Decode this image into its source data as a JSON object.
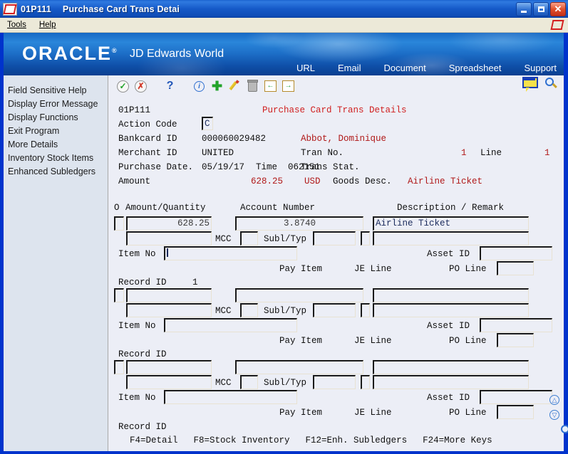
{
  "window": {
    "program_id": "01P111",
    "title": "Purchase Card Trans Detai",
    "minimize_label": "Minimize",
    "maximize_label": "Maximize",
    "close_label": "Close"
  },
  "menubar": {
    "items": [
      {
        "label": "Tools"
      },
      {
        "label": "Help"
      }
    ]
  },
  "banner": {
    "brand": "ORACLE",
    "trademark": "®",
    "product": "JD Edwards World",
    "links": [
      {
        "label": "URL"
      },
      {
        "label": "Email"
      },
      {
        "label": "Document"
      },
      {
        "label": "Spreadsheet"
      },
      {
        "label": "Support"
      }
    ]
  },
  "toolbar": {
    "icons": [
      {
        "name": "ok-check-icon",
        "label": "OK"
      },
      {
        "name": "cancel-x-icon",
        "label": "Cancel"
      },
      {
        "name": "help-question-icon",
        "label": "Help"
      },
      {
        "name": "info-icon",
        "label": "Info"
      },
      {
        "name": "add-plus-icon",
        "label": "Add"
      },
      {
        "name": "edit-pencil-icon",
        "label": "Edit"
      },
      {
        "name": "delete-trash-icon",
        "label": "Delete"
      },
      {
        "name": "previous-record-icon",
        "label": "Previous"
      },
      {
        "name": "next-record-icon",
        "label": "Next"
      }
    ],
    "note_icon_label": "Attachments",
    "search_icon_label": "Search"
  },
  "sidebar": {
    "items": [
      {
        "label": "Field Sensitive Help"
      },
      {
        "label": "Display Error Message"
      },
      {
        "label": "Display Functions"
      },
      {
        "label": "Exit Program"
      },
      {
        "label": "More Details"
      },
      {
        "label": "Inventory Stock Items"
      },
      {
        "label": "Enhanced Subledgers"
      }
    ]
  },
  "form": {
    "screen_id": "01P111",
    "screen_title": "Purchase Card Trans Details",
    "header": {
      "action_code_label": "Action Code",
      "action_code_value": "C",
      "bankcard_id_label": "Bankcard ID",
      "bankcard_id_value": "000060029482",
      "cardholder_name": "Abbot, Dominique",
      "merchant_id_label": "Merchant ID",
      "merchant_id_value": "UNITED",
      "tran_no_label": "Tran No.",
      "tran_no_value": "1",
      "line_label": "Line",
      "line_value": "1",
      "purchase_date_label": "Purchase Date.",
      "purchase_date_value": "05/19/17",
      "time_label": "Time",
      "time_value": "062151",
      "trans_stat_label": "Trans Stat.",
      "trans_stat_value": "",
      "amount_label": "Amount",
      "amount_value": "628.25",
      "currency_value": "USD",
      "goods_desc_label": "Goods Desc.",
      "goods_desc_value": "Airline Ticket"
    },
    "columns": {
      "o": "O",
      "amount_quantity": "Amount/Quantity",
      "account_number": "Account Number",
      "description_remark": "Description / Remark"
    },
    "labels": {
      "mcc": "MCC",
      "subl_typ": "Subl/Typ",
      "item_no": "Item No",
      "asset_id": "Asset ID",
      "pay_item": "Pay Item",
      "je_line": "JE Line",
      "po_line": "PO Line",
      "record_id": "Record ID"
    },
    "rows": [
      {
        "o": "",
        "amount_quantity": "628.25",
        "account_number": "3.8740",
        "description": "Airline Ticket",
        "remark": "",
        "mcc": "",
        "subl": "",
        "typ": "",
        "item_no": "",
        "asset_id": "",
        "pay_item": "",
        "je_line": "",
        "po_line": "",
        "record_id": "1"
      },
      {
        "o": "",
        "amount_quantity": "",
        "account_number": "",
        "description": "",
        "remark": "",
        "mcc": "",
        "subl": "",
        "typ": "",
        "item_no": "",
        "asset_id": "",
        "pay_item": "",
        "je_line": "",
        "po_line": "",
        "record_id": ""
      },
      {
        "o": "",
        "amount_quantity": "",
        "account_number": "",
        "description": "",
        "remark": "",
        "mcc": "",
        "subl": "",
        "typ": "",
        "item_no": "",
        "asset_id": "",
        "pay_item": "",
        "je_line": "",
        "po_line": "",
        "record_id": ""
      }
    ],
    "record_id_trailing_label": "Record ID"
  },
  "function_keys": [
    {
      "label": "F4=Detail"
    },
    {
      "label": "F8=Stock Inventory"
    },
    {
      "label": "F12=Enh. Subledgers"
    },
    {
      "label": "F24=More Keys"
    }
  ],
  "scroll_controls": {
    "up_label": "Page Up",
    "down_label": "Page Down",
    "search_label": "Search"
  },
  "colors": {
    "title_blue": "#1559c8",
    "banner_blue": "#1d6fc8",
    "accent_red": "#b01818",
    "screen_title_red": "#d02020",
    "panel_bg": "#eceef6",
    "sidebar_bg": "#dde4ee",
    "border_blue": "#0033cc"
  }
}
